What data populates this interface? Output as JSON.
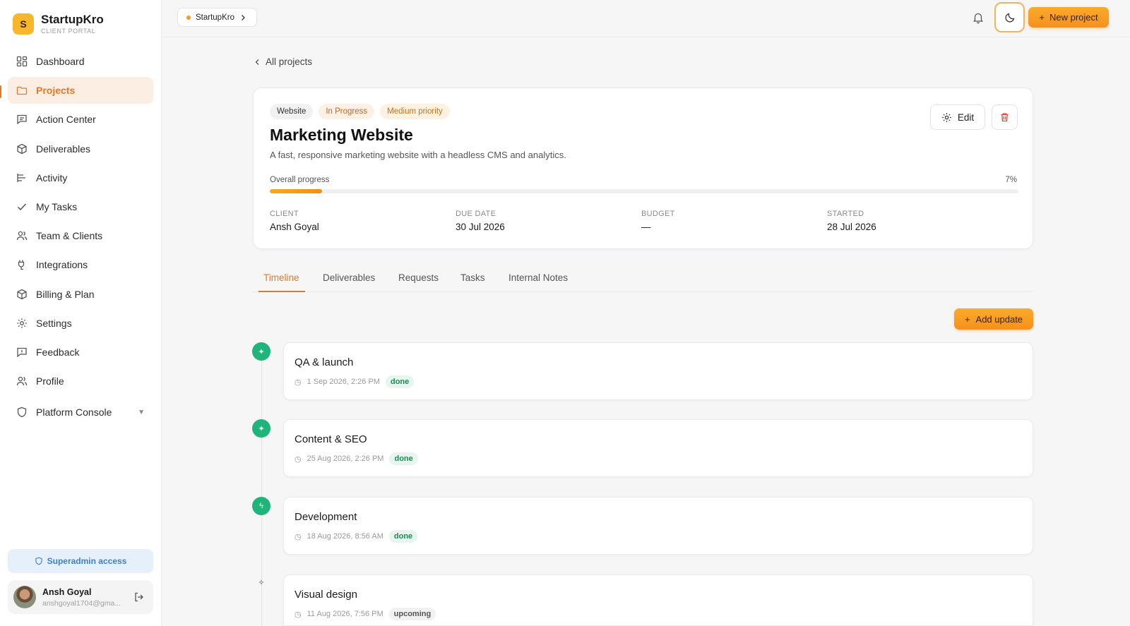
{
  "brand": {
    "initial": "S",
    "name": "StartupKro",
    "subtitle": "CLIENT PORTAL"
  },
  "sidebar": {
    "items": [
      {
        "label": "Dashboard",
        "icon": "grid-icon"
      },
      {
        "label": "Projects",
        "icon": "folder-icon",
        "active": true
      },
      {
        "label": "Action Center",
        "icon": "message-icon"
      },
      {
        "label": "Deliverables",
        "icon": "box-icon"
      },
      {
        "label": "Activity",
        "icon": "activity-icon"
      },
      {
        "label": "My Tasks",
        "icon": "check-icon"
      },
      {
        "label": "Team & Clients",
        "icon": "users-icon"
      },
      {
        "label": "Integrations",
        "icon": "plug-icon"
      },
      {
        "label": "Billing & Plan",
        "icon": "box-icon"
      },
      {
        "label": "Settings",
        "icon": "gear-icon"
      },
      {
        "label": "Feedback",
        "icon": "feedback-icon"
      },
      {
        "label": "Profile",
        "icon": "users-icon"
      }
    ],
    "console_label": "Platform Console",
    "superadmin_label": "Superadmin access",
    "user": {
      "name": "Ansh Goyal",
      "email": "anshgoyal1704@gma..."
    }
  },
  "topbar": {
    "workspace": "StartupKro",
    "new_project_label": "New project"
  },
  "project": {
    "back_label": "All projects",
    "tags": [
      "Website",
      "In Progress",
      "Medium priority"
    ],
    "title": "Marketing Website",
    "description": "A fast, responsive marketing website with a headless CMS and analytics.",
    "edit_label": "Edit",
    "progress_label": "Overall progress",
    "progress_text": "7%",
    "progress_value": 7,
    "meta": [
      {
        "label": "CLIENT",
        "value": "Ansh Goyal"
      },
      {
        "label": "DUE DATE",
        "value": "30 Jul 2026"
      },
      {
        "label": "BUDGET",
        "value": "—"
      },
      {
        "label": "STARTED",
        "value": "28 Jul 2026"
      }
    ]
  },
  "tabs": [
    "Timeline",
    "Deliverables",
    "Requests",
    "Tasks",
    "Internal Notes"
  ],
  "add_update_label": "Add update",
  "timeline": [
    {
      "title": "QA & launch",
      "time": "1 Sep 2026, 2:26 PM",
      "status": "done"
    },
    {
      "title": "Content & SEO",
      "time": "25 Aug 2026, 2:26 PM",
      "status": "done"
    },
    {
      "title": "Development",
      "time": "18 Aug 2026, 8:56 AM",
      "status": "done"
    },
    {
      "title": "Visual design",
      "time": "11 Aug 2026, 7:56 PM",
      "status": "upcoming"
    }
  ],
  "colors": {
    "accent": "#e07a2a",
    "button": "#f5a023",
    "success": "#1fb47a"
  }
}
